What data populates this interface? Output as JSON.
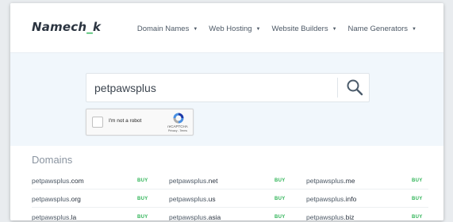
{
  "header": {
    "logo": {
      "main": "Namech",
      "accent": "_",
      "end": "k"
    },
    "nav": [
      {
        "label": "Domain Names"
      },
      {
        "label": "Web Hosting"
      },
      {
        "label": "Website Builders"
      },
      {
        "label": "Name Generators"
      }
    ]
  },
  "search": {
    "value": "petpawsplus"
  },
  "recaptcha": {
    "label": "I'm not a robot",
    "brand": "reCAPTCHA",
    "links": "Privacy - Terms"
  },
  "domains": {
    "title": "Domains",
    "buy_label": "BUY",
    "rows": [
      [
        {
          "name": "petpawsplus",
          "tld": ".com"
        },
        {
          "name": "petpawsplus",
          "tld": ".net"
        },
        {
          "name": "petpawsplus",
          "tld": ".me"
        }
      ],
      [
        {
          "name": "petpawsplus",
          "tld": ".org"
        },
        {
          "name": "petpawsplus",
          "tld": ".us"
        },
        {
          "name": "petpawsplus",
          "tld": ".info"
        }
      ],
      [
        {
          "name": "petpawsplus",
          "tld": ".la"
        },
        {
          "name": "petpawsplus",
          "tld": ".asia"
        },
        {
          "name": "petpawsplus",
          "tld": ".biz"
        }
      ]
    ]
  },
  "colors": {
    "brand_dark": "#2b3440",
    "accent_green": "#2fb457",
    "search_band": "#f1f7fc"
  },
  "icons": {
    "search": "magnifier-icon",
    "nav_caret": "caret-down-icon",
    "recaptcha": "recaptcha-logo-icon"
  }
}
